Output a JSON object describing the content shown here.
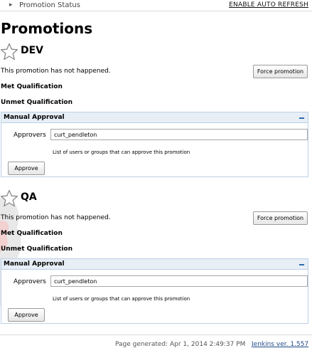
{
  "topbar": {
    "breadcrumb": "Promotion Status",
    "auto_refresh": "ENABLE AUTO REFRESH"
  },
  "page_title": "Promotions",
  "promotions": [
    {
      "name": "DEV",
      "icon": "star-outline-icon",
      "status": "This promotion has not happened.",
      "force_label": "Force promotion",
      "met_label": "Met Qualification",
      "unmet_label": "Unmet Qualification",
      "panel_title": "Manual Approval",
      "approvers_label": "Approvers",
      "approvers_value": "curt_pendleton",
      "approvers_hint": "List of users or groups that can approve this promotion",
      "approve_label": "Approve"
    },
    {
      "name": "QA",
      "icon": "star-outline-icon",
      "status": "This promotion has not happened.",
      "force_label": "Force promotion",
      "met_label": "Met Qualification",
      "unmet_label": "Unmet Qualification",
      "panel_title": "Manual Approval",
      "approvers_label": "Approvers",
      "approvers_value": "curt_pendleton",
      "approvers_hint": "List of users or groups that can approve this promotion",
      "approve_label": "Approve"
    }
  ],
  "footer": {
    "generated": "Page generated: Apr 1, 2014 2:49:37 PM",
    "version": "Jenkins ver. 1.557"
  },
  "colors": {
    "panel_header": "#e7eef6",
    "panel_border": "#bcd0e5",
    "link": "#204a87",
    "collapse_icon": "#2d6aa8"
  }
}
